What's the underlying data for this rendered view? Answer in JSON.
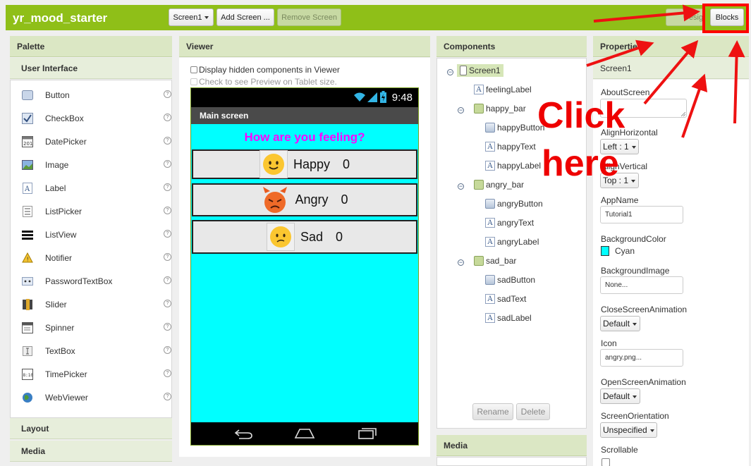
{
  "app": {
    "title": "yr_mood_starter"
  },
  "toolbar": {
    "screen_dropdown": "Screen1",
    "add_screen": "Add Screen ...",
    "remove_screen": "Remove Screen",
    "designer": "Designer",
    "blocks": "Blocks"
  },
  "palette": {
    "title": "Palette",
    "section_ui": "User Interface",
    "items": [
      {
        "label": "Button",
        "icon": "button-icon"
      },
      {
        "label": "CheckBox",
        "icon": "checkbox-icon"
      },
      {
        "label": "DatePicker",
        "icon": "datepicker-icon"
      },
      {
        "label": "Image",
        "icon": "image-icon"
      },
      {
        "label": "Label",
        "icon": "label-icon"
      },
      {
        "label": "ListPicker",
        "icon": "listpicker-icon"
      },
      {
        "label": "ListView",
        "icon": "listview-icon"
      },
      {
        "label": "Notifier",
        "icon": "notifier-icon"
      },
      {
        "label": "PasswordTextBox",
        "icon": "password-icon"
      },
      {
        "label": "Slider",
        "icon": "slider-icon"
      },
      {
        "label": "Spinner",
        "icon": "spinner-icon"
      },
      {
        "label": "TextBox",
        "icon": "textbox-icon"
      },
      {
        "label": "TimePicker",
        "icon": "timepicker-icon"
      },
      {
        "label": "WebViewer",
        "icon": "webviewer-icon"
      }
    ],
    "help_glyph": "?",
    "section_layout": "Layout",
    "section_media": "Media"
  },
  "viewer": {
    "title": "Viewer",
    "hidden_components": "Display hidden components in Viewer",
    "tablet_preview": "Check to see Preview on Tablet size.",
    "clock": "9:48",
    "screen_title": "Main screen",
    "feeling_label": "How are you feeling?",
    "moods": [
      {
        "label": "Happy",
        "count": "0",
        "icon": "happy-emoji-icon"
      },
      {
        "label": "Angry",
        "count": "0",
        "icon": "angry-emoji-icon"
      },
      {
        "label": "Sad",
        "count": "0",
        "icon": "sad-emoji-icon"
      }
    ]
  },
  "components": {
    "title": "Components",
    "tree": [
      {
        "name": "Screen1",
        "type": "screen"
      },
      {
        "name": "feelingLabel",
        "type": "label"
      },
      {
        "name": "happy_bar",
        "type": "arrangement"
      },
      {
        "name": "happyButton",
        "type": "button"
      },
      {
        "name": "happyText",
        "type": "label"
      },
      {
        "name": "happyLabel",
        "type": "label"
      },
      {
        "name": "angry_bar",
        "type": "arrangement"
      },
      {
        "name": "angryButton",
        "type": "button"
      },
      {
        "name": "angryText",
        "type": "label"
      },
      {
        "name": "angryLabel",
        "type": "label"
      },
      {
        "name": "sad_bar",
        "type": "arrangement"
      },
      {
        "name": "sadButton",
        "type": "button"
      },
      {
        "name": "sadText",
        "type": "label"
      },
      {
        "name": "sadLabel",
        "type": "label"
      }
    ],
    "toggle_glyph": "−",
    "label_icon_glyph": "A",
    "rename": "Rename",
    "delete": "Delete",
    "media_title": "Media"
  },
  "properties": {
    "title": "Properties",
    "component": "Screen1",
    "about_screen": "AboutScreen",
    "align_horizontal": "AlignHorizontal",
    "align_horizontal_value": "Left : 1",
    "align_vertical": "AlignVertical",
    "align_vertical_value": "Top : 1",
    "app_name": "AppName",
    "app_name_value": "Tutorial1",
    "background_color": "BackgroundColor",
    "background_color_value": "Cyan",
    "background_color_hex": "#00ffff",
    "background_image": "BackgroundImage",
    "background_image_value": "None...",
    "close_screen_animation": "CloseScreenAnimation",
    "close_screen_animation_value": "Default",
    "icon": "Icon",
    "icon_value": "angry.png...",
    "open_screen_animation": "OpenScreenAnimation",
    "open_screen_animation_value": "Default",
    "screen_orientation": "ScreenOrientation",
    "screen_orientation_value": "Unspecified",
    "scrollable": "Scrollable"
  },
  "annotation": {
    "line1": "Click",
    "line2": "here",
    "color": "#ee0000"
  }
}
